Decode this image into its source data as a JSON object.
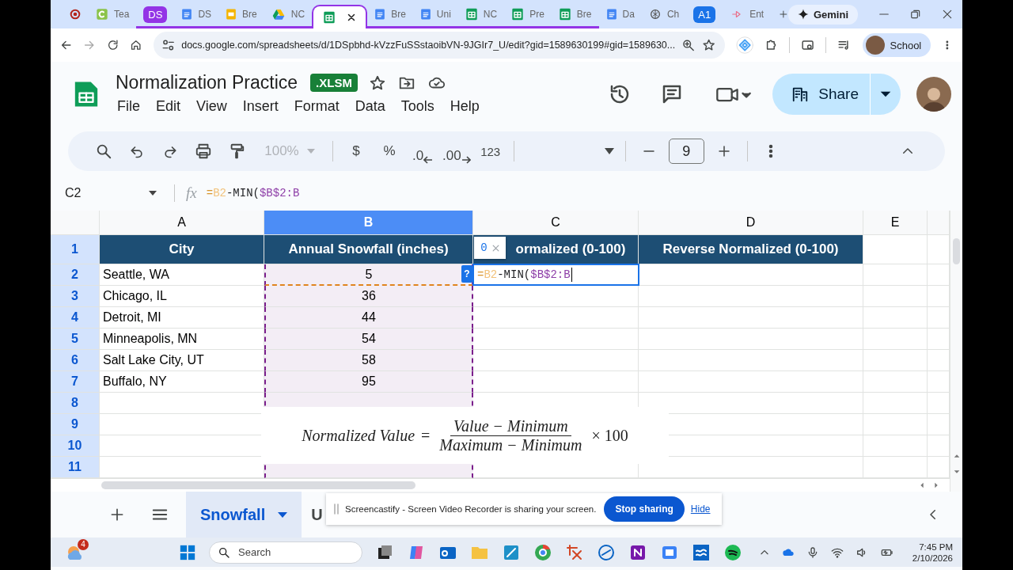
{
  "browser": {
    "tabs": [
      {
        "kind": "record",
        "selected": false,
        "grouped": false
      },
      {
        "kind": "classroom",
        "label": "Tea",
        "selected": false,
        "grouped": false
      },
      {
        "kind": "group",
        "label": "DS",
        "color": "#9334e6",
        "selected": false,
        "grouped": true
      },
      {
        "kind": "docs",
        "label": "DS",
        "selected": false,
        "grouped": true
      },
      {
        "kind": "slides",
        "label": "Bre",
        "selected": false,
        "grouped": true
      },
      {
        "kind": "drive",
        "label": "NC",
        "selected": false,
        "grouped": true
      },
      {
        "kind": "sheets",
        "selected": true,
        "grouped": true
      },
      {
        "kind": "docs",
        "label": "Bre",
        "selected": false,
        "grouped": true
      },
      {
        "kind": "docs",
        "label": "Uni",
        "selected": false,
        "grouped": true
      },
      {
        "kind": "sheets",
        "label": "NC",
        "selected": false,
        "grouped": true
      },
      {
        "kind": "sheets",
        "label": "Pre",
        "selected": false,
        "grouped": true
      },
      {
        "kind": "sheets",
        "label": "Bre",
        "selected": false,
        "grouped": true
      },
      {
        "kind": "docs",
        "label": "Da",
        "selected": false,
        "grouped": false
      },
      {
        "kind": "chat",
        "label": "Ch",
        "selected": false,
        "grouped": false
      },
      {
        "kind": "group",
        "label": "A1",
        "color": "#1a73e8",
        "selected": false,
        "grouped": false
      },
      {
        "kind": "arrow",
        "label": "Ent",
        "selected": false,
        "grouped": false
      }
    ],
    "gemini": "Gemini",
    "url": "docs.google.com/spreadsheets/d/1DSpbhd-kVzzFuSSstaoibVN-9JGIr7_U/edit?gid=1589630199#gid=1589630...",
    "profile": "School"
  },
  "doc": {
    "title": "Normalization Practice",
    "format_badge": ".XLSM",
    "menus": [
      "File",
      "Edit",
      "View",
      "Insert",
      "Format",
      "Data",
      "Tools",
      "Help"
    ],
    "share": "Share"
  },
  "toolbar": {
    "zoom": "100%",
    "currency": "$",
    "percent": "%",
    "decrease_decimals": ".0",
    "increase_decimals": ".00",
    "number_format": "123",
    "font_size": "9"
  },
  "formula_bar": {
    "name_box": "C2",
    "fx": "fx",
    "formula": [
      {
        "text": "=",
        "color": "#d9952e"
      },
      {
        "text": "B2",
        "color": "#f2c27b"
      },
      {
        "text": "-MIN(",
        "color": "#202124"
      },
      {
        "text": "$B$2:B",
        "color": "#8e3fa8"
      }
    ]
  },
  "sheet": {
    "columns": [
      {
        "label": "A",
        "selected": false
      },
      {
        "label": "B",
        "selected": true
      },
      {
        "label": "C",
        "selected": false
      },
      {
        "label": "D",
        "selected": false
      },
      {
        "label": "E",
        "selected": false
      }
    ],
    "rows": [
      {
        "number": "1",
        "kind": "header",
        "cells": [
          "City",
          "Annual Snowfall (inches)",
          "ormalized (0-100)",
          "Reverse Normalized (0-100)"
        ]
      },
      {
        "number": "2",
        "kind": "data",
        "referenced": true,
        "cells": [
          "Seattle, WA",
          "5"
        ],
        "editor": {
          "help": "?",
          "preview": "0",
          "formula": [
            {
              "text": "=",
              "color": "#d9952e"
            },
            {
              "text": "B2",
              "color": "#f2c27b"
            },
            {
              "text": "-MIN(",
              "color": "#202124"
            },
            {
              "text": "$B$2:B",
              "color": "#8e3fa8"
            }
          ]
        }
      },
      {
        "number": "3",
        "kind": "data",
        "cells": [
          "Chicago, IL",
          "36"
        ]
      },
      {
        "number": "4",
        "kind": "data",
        "cells": [
          "Detroit, MI",
          "44"
        ]
      },
      {
        "number": "5",
        "kind": "data",
        "cells": [
          "Minneapolis, MN",
          "54"
        ]
      },
      {
        "number": "6",
        "kind": "data",
        "cells": [
          "Salt Lake City, UT",
          "58"
        ]
      },
      {
        "number": "7",
        "kind": "data",
        "cells": [
          "Buffalo, NY",
          "95"
        ]
      },
      {
        "number": "8",
        "kind": "data"
      },
      {
        "number": "9",
        "kind": "data"
      },
      {
        "number": "10",
        "kind": "data"
      },
      {
        "number": "11",
        "kind": "data"
      }
    ],
    "formula_image": {
      "lhs": "Normalized Value",
      "equals": "=",
      "numerator": "Value − Minimum",
      "denominator": "Maximum − Minimum",
      "factor": "× 100"
    }
  },
  "sheet_tabs": [
    {
      "label": "Snowfall",
      "selected": true
    },
    {
      "label": "U",
      "selected": false
    }
  ],
  "share_banner": {
    "message": "Screencastify - Screen Video Recorder is sharing your screen.",
    "stop": "Stop sharing",
    "hide": "Hide"
  },
  "taskbar": {
    "weather_badge": "4",
    "search": "Search",
    "time": "7:45 PM",
    "date": "2/10/2026"
  }
}
